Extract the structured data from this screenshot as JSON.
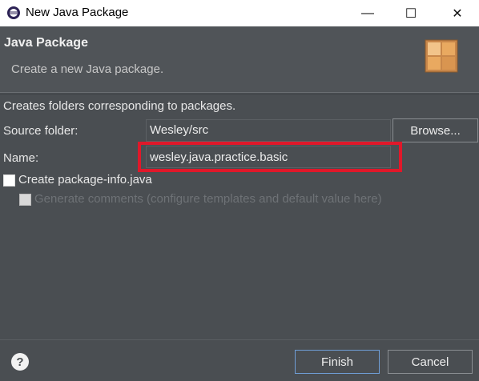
{
  "window": {
    "title": "New Java Package",
    "minimize_glyph": "—",
    "maximize_glyph": "☐",
    "close_glyph": "✕",
    "app_icon": "eclipse-icon"
  },
  "header": {
    "title": "Java Package",
    "description": "Create a new Java package.",
    "image_icon": "package-wizard-icon"
  },
  "form": {
    "info": "Creates folders corresponding to packages.",
    "source_folder_label": "Source folder:",
    "source_folder_value": "Wesley/src",
    "browse_label": "Browse...",
    "name_label": "Name:",
    "name_value": "wesley.java.practice.basic",
    "create_package_info_label": "Create package-info.java",
    "create_package_info_checked": false,
    "generate_comments_label": "Generate comments (configure templates and default value here)",
    "generate_comments_enabled": false
  },
  "footer": {
    "help_glyph": "?",
    "finish_label": "Finish",
    "cancel_label": "Cancel"
  },
  "colors": {
    "highlight": "#e0182a",
    "background": "#4a4e52",
    "default_button_border": "#6f9ed6"
  }
}
